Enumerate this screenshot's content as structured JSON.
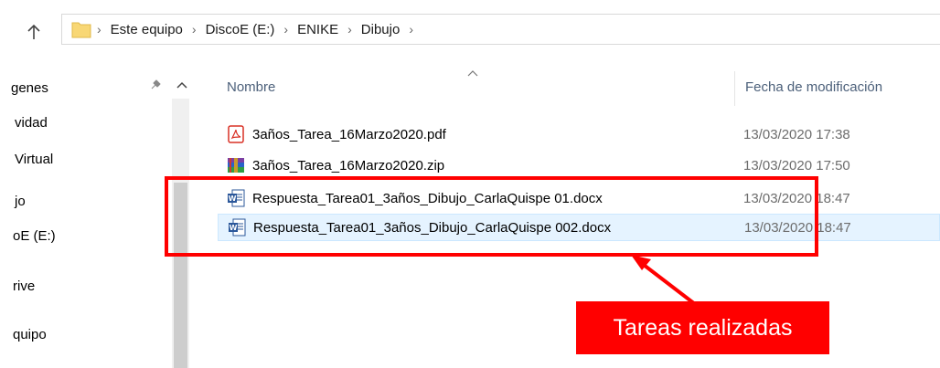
{
  "address_bar": {
    "crumbs": [
      "Este equipo",
      "DiscoE (E:)",
      "ENIKE",
      "Dibujo"
    ]
  },
  "nav": {
    "items": [
      "genes",
      "vidad",
      "Virtual",
      "jo",
      "oE (E:)",
      "rive",
      "quipo"
    ]
  },
  "list": {
    "columns": {
      "name": "Nombre",
      "date": "Fecha de modificación"
    },
    "files": [
      {
        "name": "3años_Tarea_16Marzo2020.pdf",
        "date": "13/03/2020 17:38",
        "icon": "pdf-icon",
        "selected": false
      },
      {
        "name": "3años_Tarea_16Marzo2020.zip",
        "date": "13/03/2020 17:50",
        "icon": "winrar-icon",
        "selected": false
      },
      {
        "name": "Respuesta_Tarea01_3años_Dibujo_CarlaQuispe 01.docx",
        "date": "13/03/2020 18:47",
        "icon": "word-doc-icon",
        "selected": false
      },
      {
        "name": "Respuesta_Tarea01_3años_Dibujo_CarlaQuispe 002.docx",
        "date": "13/03/2020 18:47",
        "icon": "word-doc-icon",
        "selected": true
      }
    ]
  },
  "annotation": {
    "label": "Tareas realizadas",
    "color": "#ff0000"
  }
}
